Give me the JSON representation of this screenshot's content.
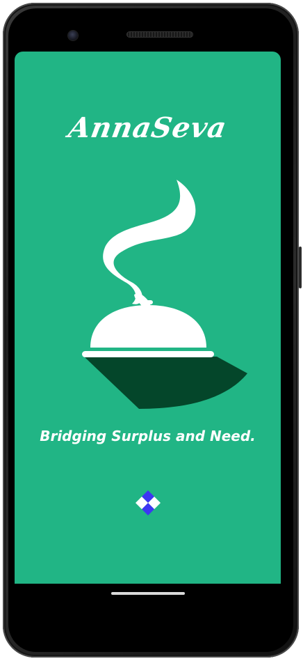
{
  "app": {
    "title": "AnnaSeva",
    "tagline": "Bridging Surplus and Need."
  },
  "icons": {
    "logo": "food-cloche-steam-icon",
    "loader": "loading-diamonds-icon"
  },
  "colors": {
    "background": "#21b585",
    "shadow": "#04462a",
    "text": "#ffffff",
    "loader_primary": "#3d36f2",
    "loader_secondary": "#ffffff"
  }
}
